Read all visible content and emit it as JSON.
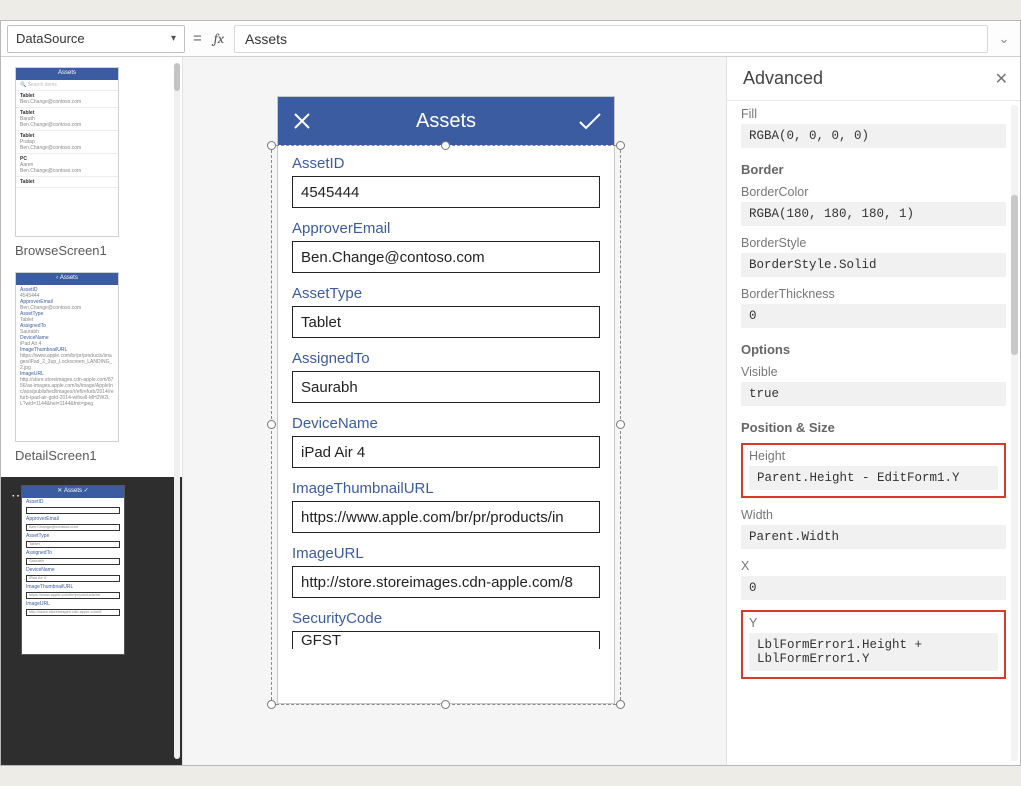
{
  "formulaBar": {
    "propertyName": "DataSource",
    "equals": "=",
    "fx": "fx",
    "formula": "Assets"
  },
  "thumbnails": {
    "browse": {
      "title": "Assets",
      "rows": [
        {
          "title": "Tablet",
          "sub": "Ben.Change@contoso.com"
        },
        {
          "title": "Tablet",
          "sub": "Ben.Change@contoso.com",
          "name": "Barath"
        },
        {
          "title": "Tablet",
          "sub": "Ben.Change@contoso.com",
          "name": "Pratap"
        },
        {
          "title": "PC",
          "sub": "Ben.Change@contoso.com",
          "name": "Aaren"
        },
        {
          "title": "Tablet",
          "sub": ""
        }
      ],
      "label": "BrowseScreen1"
    },
    "detail": {
      "title": "Assets",
      "fields": [
        {
          "k": "AssetID",
          "v": "4545444"
        },
        {
          "k": "ApproverEmail",
          "v": "Ben.Change@contoso.com"
        },
        {
          "k": "AssetType",
          "v": "Tablet"
        },
        {
          "k": "AssignedTo",
          "v": "Saurabh"
        },
        {
          "k": "DeviceName",
          "v": "iPad Air 4"
        },
        {
          "k": "ImageThumbnailURL",
          "v": "https://www.apple.com/br/pr/products/images/iPad_2_3up_Lockscreen_LANDING_2.jpg"
        },
        {
          "k": "ImageURL",
          "v": "http://store.storeimages.cdn-apple.com/8756/as-images.apple.com/is/image/AppleInc/aos/published/images/r/ef/refurb/2014/refurb-ipad-air-gold-2014-wificell-MH2W2LL?wid=1144&hei=1144&fmt=jpeg"
        }
      ],
      "label": "DetailScreen1"
    },
    "edit": {
      "title": "Assets",
      "fields": [
        {
          "k": "AssetID",
          "v": ""
        },
        {
          "k": "ApproverEmail",
          "v": "Ben.Change@contoso.com"
        },
        {
          "k": "AssetType",
          "v": "Tablet"
        },
        {
          "k": "AssignedTo",
          "v": "Saurabh"
        },
        {
          "k": "DeviceName",
          "v": "iPad Air 4"
        },
        {
          "k": "ImageThumbnailURL",
          "v": "https://www.apple.com/br/pr/products/im"
        },
        {
          "k": "ImageURL",
          "v": "http://store.storeimages.cdn-apple.com/8"
        }
      ]
    }
  },
  "phone": {
    "title": "Assets",
    "fields": [
      {
        "label": "AssetID",
        "value": "4545444"
      },
      {
        "label": "ApproverEmail",
        "value": "Ben.Change@contoso.com"
      },
      {
        "label": "AssetType",
        "value": "Tablet"
      },
      {
        "label": "AssignedTo",
        "value": "Saurabh"
      },
      {
        "label": "DeviceName",
        "value": "iPad Air 4"
      },
      {
        "label": "ImageThumbnailURL",
        "value": "https://www.apple.com/br/pr/products/in"
      },
      {
        "label": "ImageURL",
        "value": "http://store.storeimages.cdn-apple.com/8"
      },
      {
        "label": "SecurityCode",
        "value": "GFST"
      }
    ]
  },
  "advanced": {
    "title": "Advanced",
    "sections": {
      "fillLabel": "Fill",
      "fillValue": "RGBA(0, 0, 0, 0)",
      "borderTitle": "Border",
      "borderColorLabel": "BorderColor",
      "borderColorValue": "RGBA(180, 180, 180, 1)",
      "borderStyleLabel": "BorderStyle",
      "borderStyleValue": "BorderStyle.Solid",
      "borderThickLabel": "BorderThickness",
      "borderThickValue": "0",
      "optionsTitle": "Options",
      "visibleLabel": "Visible",
      "visibleValue": "true",
      "posTitle": "Position & Size",
      "heightLabel": "Height",
      "heightValue": "Parent.Height - EditForm1.Y",
      "widthLabel": "Width",
      "widthValue": "Parent.Width",
      "xLabel": "X",
      "xValue": "0",
      "yLabel": "Y",
      "yValue": "LblFormError1.Height +\nLblFormError1.Y"
    }
  }
}
